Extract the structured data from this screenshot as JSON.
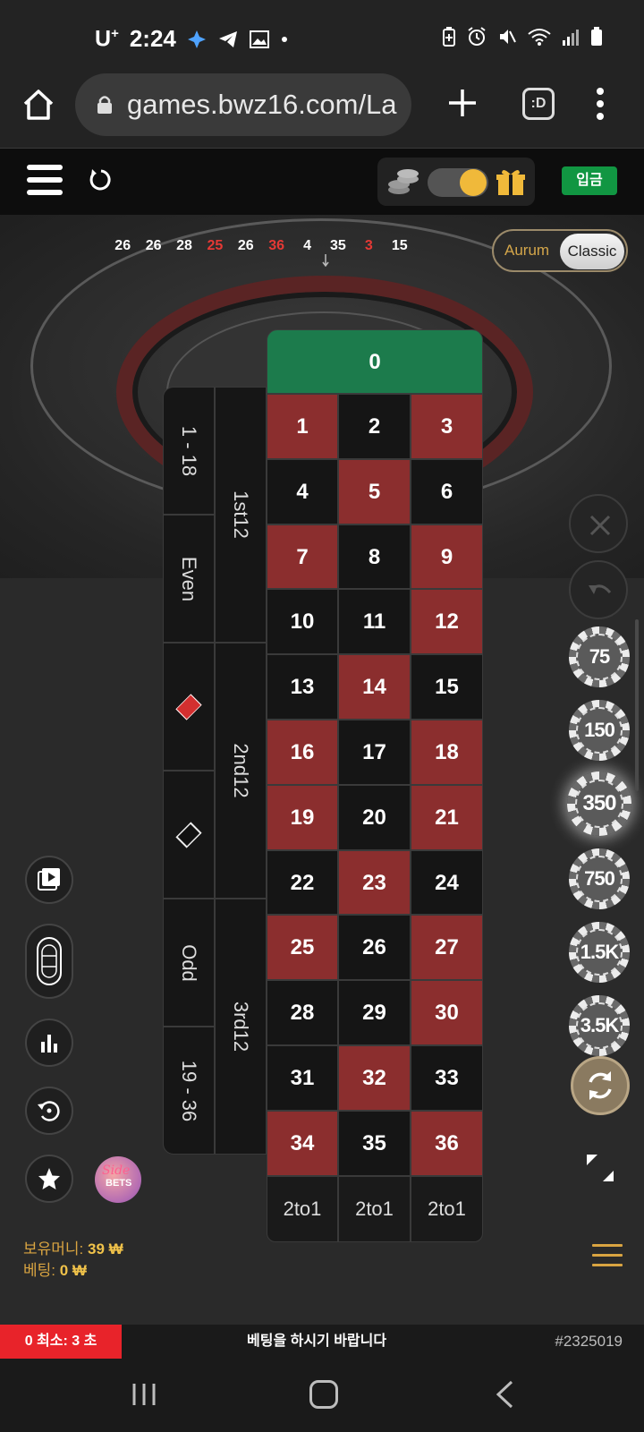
{
  "status_bar": {
    "carrier": "U",
    "carrier_sup": "+",
    "time": "2:24"
  },
  "browser": {
    "url": "games.bwz16.com/La",
    "tabs_label": ":D"
  },
  "header": {
    "deposit_label": "입금"
  },
  "recent_results": [
    {
      "n": "26",
      "color": "#ffffff"
    },
    {
      "n": "26",
      "color": "#ffffff"
    },
    {
      "n": "28",
      "color": "#ffffff"
    },
    {
      "n": "25",
      "color": "#e53935"
    },
    {
      "n": "26",
      "color": "#ffffff"
    },
    {
      "n": "36",
      "color": "#e53935"
    },
    {
      "n": "4",
      "color": "#ffffff"
    },
    {
      "n": "35",
      "color": "#ffffff"
    },
    {
      "n": "3",
      "color": "#e53935"
    },
    {
      "n": "15",
      "color": "#ffffff"
    }
  ],
  "table_toggle": {
    "aurum": "Aurum",
    "classic": "Classic",
    "selected": "Classic"
  },
  "board": {
    "zero": "0",
    "numbers": [
      {
        "n": "1",
        "c": "red"
      },
      {
        "n": "2",
        "c": "black"
      },
      {
        "n": "3",
        "c": "red"
      },
      {
        "n": "4",
        "c": "black"
      },
      {
        "n": "5",
        "c": "red"
      },
      {
        "n": "6",
        "c": "black"
      },
      {
        "n": "7",
        "c": "red"
      },
      {
        "n": "8",
        "c": "black"
      },
      {
        "n": "9",
        "c": "red"
      },
      {
        "n": "10",
        "c": "black"
      },
      {
        "n": "11",
        "c": "black"
      },
      {
        "n": "12",
        "c": "red"
      },
      {
        "n": "13",
        "c": "black"
      },
      {
        "n": "14",
        "c": "red"
      },
      {
        "n": "15",
        "c": "black"
      },
      {
        "n": "16",
        "c": "red"
      },
      {
        "n": "17",
        "c": "black"
      },
      {
        "n": "18",
        "c": "red"
      },
      {
        "n": "19",
        "c": "red"
      },
      {
        "n": "20",
        "c": "black"
      },
      {
        "n": "21",
        "c": "red"
      },
      {
        "n": "22",
        "c": "black"
      },
      {
        "n": "23",
        "c": "red"
      },
      {
        "n": "24",
        "c": "black"
      },
      {
        "n": "25",
        "c": "red"
      },
      {
        "n": "26",
        "c": "black"
      },
      {
        "n": "27",
        "c": "red"
      },
      {
        "n": "28",
        "c": "black"
      },
      {
        "n": "29",
        "c": "black"
      },
      {
        "n": "30",
        "c": "red"
      },
      {
        "n": "31",
        "c": "black"
      },
      {
        "n": "32",
        "c": "red"
      },
      {
        "n": "33",
        "c": "black"
      },
      {
        "n": "34",
        "c": "red"
      },
      {
        "n": "35",
        "c": "black"
      },
      {
        "n": "36",
        "c": "red"
      }
    ],
    "columns": [
      "2to1",
      "2to1",
      "2to1"
    ],
    "dozens": [
      "1st12",
      "2nd12",
      "3rd12"
    ],
    "outside": {
      "low": "1 - 18",
      "even": "Even",
      "odd": "Odd",
      "high": "19 - 36"
    }
  },
  "chips": [
    "75",
    "150",
    "350",
    "750",
    "1.5K",
    "3.5K"
  ],
  "selected_chip": "350",
  "sidebets": {
    "line1": "Side",
    "line2": "BETS"
  },
  "balance": {
    "money_label": "보유머니:",
    "money_value": "39 ₩",
    "bet_label": "베팅:",
    "bet_value": "0 ₩"
  },
  "info_bar": {
    "timer": "0 최소: 3 초",
    "message": "베팅을 하시기 바랍니다",
    "round_id": "#2325019"
  },
  "colors": {
    "red": "#8b2e2e",
    "black": "#151515",
    "zero": "#1c7b4c",
    "deposit": "#119642",
    "timer": "#e8232a"
  }
}
